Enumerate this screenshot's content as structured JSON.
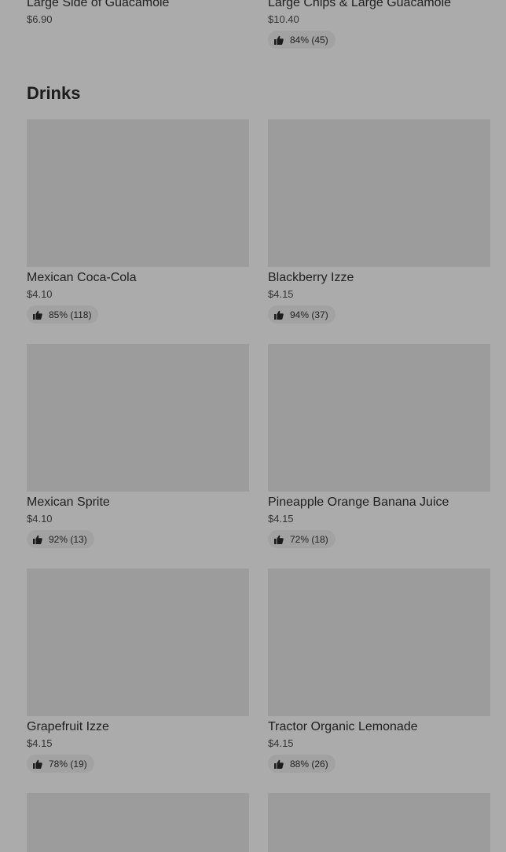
{
  "top_items": [
    {
      "name": "Large Side of Guacamole",
      "price": "$6.90",
      "rating": ""
    },
    {
      "name": "Large Chips & Large Guacamole",
      "price": "$10.40",
      "rating": "84% (45)"
    }
  ],
  "section": {
    "title": "Drinks"
  },
  "drinks": [
    {
      "name": "Mexican Coca-Cola",
      "price": "$4.10",
      "rating": "85% (118)"
    },
    {
      "name": "Blackberry Izze",
      "price": "$4.15",
      "rating": "94% (37)"
    },
    {
      "name": "Mexican Sprite",
      "price": "$4.10",
      "rating": "92% (13)"
    },
    {
      "name": "Pineapple Orange Banana Juice",
      "price": "$4.15",
      "rating": "72% (18)"
    },
    {
      "name": "Grapefruit Izze",
      "price": "$4.15",
      "rating": "78% (19)"
    },
    {
      "name": "Tractor Organic Lemonade",
      "price": "$4.15",
      "rating": "88% (26)"
    }
  ],
  "icons": {
    "rating": "thumbs-up-icon"
  },
  "colors": {
    "overlay": "#ababab",
    "image_placeholder": "#9c9c9c",
    "rating_pill": "#a2a2a2"
  }
}
